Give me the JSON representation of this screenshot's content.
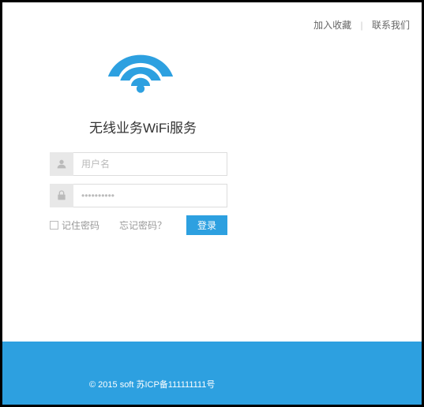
{
  "nav": {
    "favorite": "加入收藏",
    "contact": "联系我们"
  },
  "title": "无线业务WiFi服务",
  "form": {
    "username_placeholder": "用户名",
    "password_placeholder": "••••••••••",
    "remember_label": "记住密码",
    "forgot_label": "忘记密码？",
    "login_label": "登录"
  },
  "footer": {
    "copyright": "© 2015 soft 苏ICP备111111111号"
  },
  "colors": {
    "accent": "#2da0e0"
  }
}
